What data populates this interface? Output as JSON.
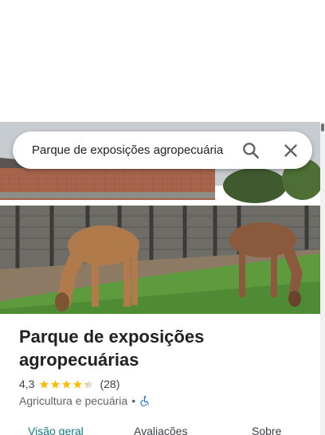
{
  "search": {
    "query": "Parque de exposições agropecuária"
  },
  "place": {
    "title": "Parque de exposições agropecuárias",
    "rating": "4,3",
    "stars_filled": 4.3,
    "reviews": "(28)",
    "category": "Agricultura e pecuária",
    "separator": "•"
  },
  "tabs": [
    {
      "label": "Visão geral",
      "active": true
    },
    {
      "label": "Avaliações",
      "active": false
    },
    {
      "label": "Sobre",
      "active": false
    }
  ],
  "icons": {
    "search": "search-icon",
    "close": "close-icon",
    "accessibility": "wheelchair-icon",
    "star": "star-icon"
  },
  "colors": {
    "accent": "#137a7f",
    "star": "#fbbc04",
    "accessibility": "#1a73e8"
  }
}
